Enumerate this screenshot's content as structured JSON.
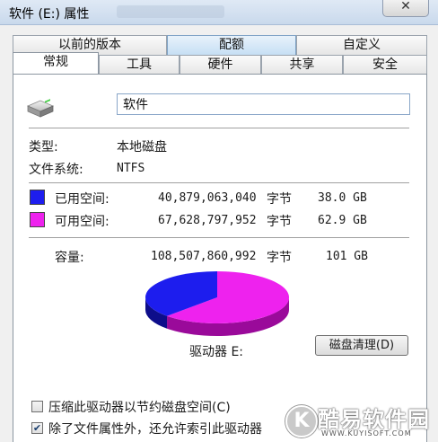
{
  "window": {
    "title": "软件 (E:) 属性",
    "close_glyph": "✕"
  },
  "tabs_back": [
    {
      "label": "以前的版本"
    },
    {
      "label": "配额"
    },
    {
      "label": "自定义"
    }
  ],
  "tabs_front": [
    {
      "label": "常规",
      "active": true
    },
    {
      "label": "工具"
    },
    {
      "label": "硬件"
    },
    {
      "label": "共享"
    },
    {
      "label": "安全"
    }
  ],
  "volume": {
    "name_value": "软件"
  },
  "info": {
    "type_label": "类型:",
    "type_value": "本地磁盘",
    "fs_label": "文件系统:",
    "fs_value": "NTFS"
  },
  "usage": {
    "used_label": "已用空间:",
    "used_bytes": "40,879,063,040",
    "used_unit": "字节",
    "used_size": "38.0 GB",
    "free_label": "可用空间:",
    "free_bytes": "67,628,797,952",
    "free_unit": "字节",
    "free_size": "62.9 GB",
    "capacity_label": "容量:",
    "capacity_bytes": "108,507,860,992",
    "capacity_unit": "字节",
    "capacity_size": "101 GB",
    "used_fraction": 0.3767,
    "used_color": "#1d1dee",
    "free_color": "#ee22ee",
    "free_side_color": "#9a0a9a",
    "used_side_color": "#0d0d8a"
  },
  "drive_label": "驱动器 E:",
  "cleanup_button": "磁盘清理(D)",
  "options": {
    "compress_label": "压缩此驱动器以节约磁盘空间(C)",
    "compress_checked": false,
    "index_label": "除了文件属性外，还允许索引此驱动器",
    "index_checked": true
  },
  "watermark": {
    "glyph": "K",
    "text": "酷易软件园",
    "url": "WWW.KUYISOFT.COM"
  }
}
